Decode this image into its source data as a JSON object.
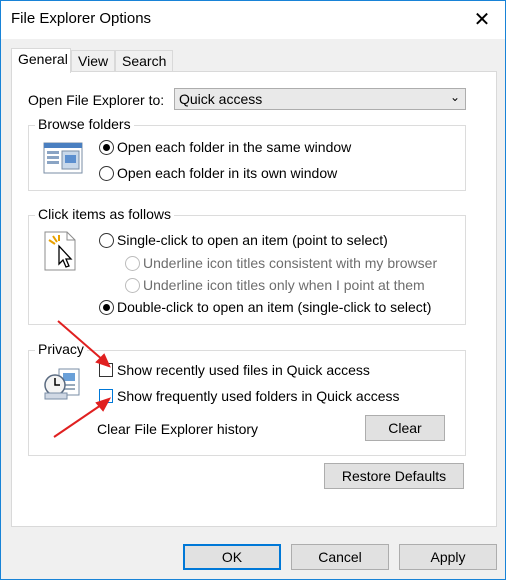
{
  "window": {
    "title": "File Explorer Options",
    "close_glyph": "✕"
  },
  "tabs": [
    {
      "label": "General",
      "active": true
    },
    {
      "label": "View",
      "active": false
    },
    {
      "label": "Search",
      "active": false
    }
  ],
  "open_in": {
    "label": "Open File Explorer to:",
    "value": "Quick access"
  },
  "browse": {
    "legend": "Browse folders",
    "same_window": "Open each folder in the same window",
    "own_window": "Open each folder in its own window"
  },
  "click": {
    "legend": "Click items as follows",
    "single": "Single-click to open an item (point to select)",
    "underline_browser": "Underline icon titles consistent with my browser",
    "underline_point": "Underline icon titles only when I point at them",
    "double": "Double-click to open an item (single-click to select)"
  },
  "privacy": {
    "legend": "Privacy",
    "recent_files": "Show recently used files in Quick access",
    "frequent_folders": "Show frequently used folders in Quick access",
    "clear_label": "Clear File Explorer history",
    "clear_button": "Clear"
  },
  "restore_button": "Restore Defaults",
  "footer": {
    "ok": "OK",
    "cancel": "Cancel",
    "apply": "Apply"
  },
  "colors": {
    "accent": "#0078d7",
    "annotation_arrow": "#e02020"
  }
}
